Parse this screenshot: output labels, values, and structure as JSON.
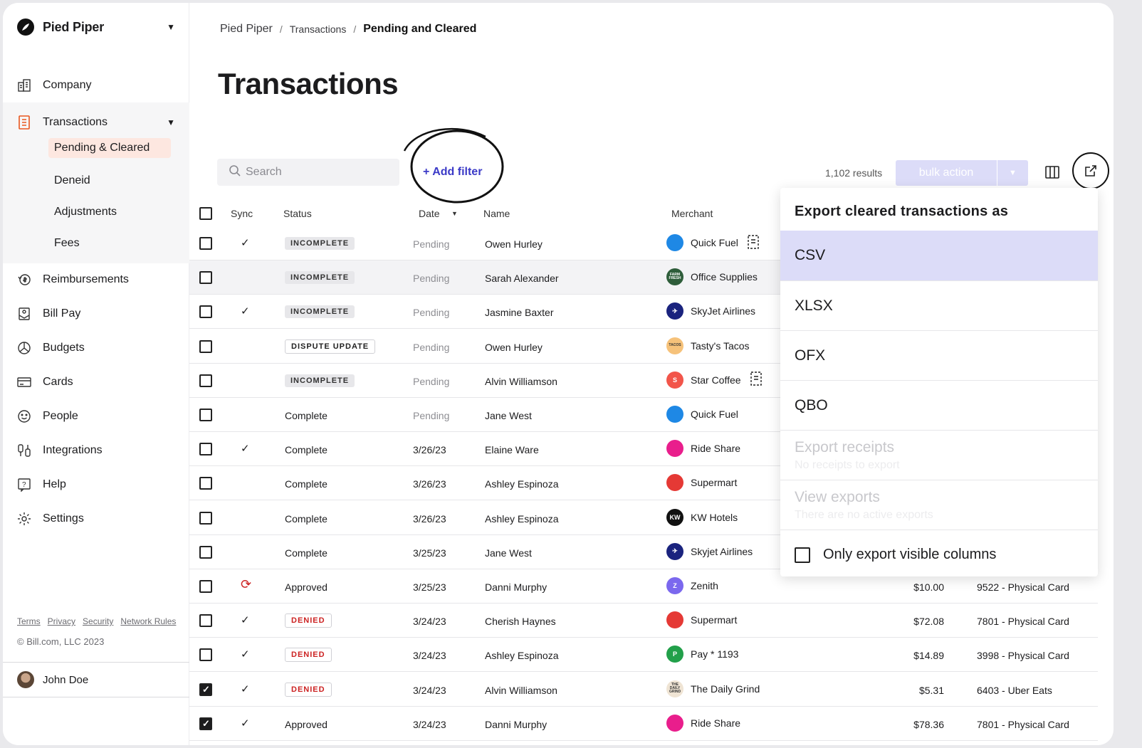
{
  "org": {
    "name": "Pied Piper"
  },
  "nav": {
    "company": "Company",
    "transactions": "Transactions",
    "sub": [
      "Pending & Cleared",
      "Deneid",
      "Adjustments",
      "Fees"
    ],
    "reimbursements": "Reimbursements",
    "bill_pay": "Bill Pay",
    "budgets": "Budgets",
    "cards": "Cards",
    "people": "People",
    "integrations": "Integrations",
    "help": "Help",
    "settings": "Settings"
  },
  "footer": {
    "links": [
      "Terms",
      "Privacy",
      "Security",
      "Network Rules"
    ],
    "copyright": "© Bill.com, LLC 2023"
  },
  "user": {
    "name": "John Doe"
  },
  "breadcrumb": [
    "Pied Piper",
    "Transactions",
    "Pending and Cleared"
  ],
  "page_title": "Transactions",
  "search": {
    "placeholder": "Search"
  },
  "add_filter": "+ Add filter",
  "results": "1,102 results",
  "bulk_action": "bulk action",
  "table": {
    "headers": [
      "Sync",
      "Status",
      "Date",
      "Name",
      "Merchant"
    ],
    "rows": [
      {
        "checked": false,
        "sync": "✓",
        "status": "INCOMPLETE",
        "status_style": "gray",
        "date": "Pending",
        "name": "Owen Hurley",
        "merchant": "Quick Fuel",
        "logo_color": "#1e88e5",
        "logo_text": "",
        "receipt": true,
        "amount": "",
        "card": ""
      },
      {
        "checked": false,
        "sync": "",
        "status": "INCOMPLETE",
        "status_style": "gray",
        "date": "Pending",
        "name": "Sarah Alexander",
        "merchant": "Office Supplies",
        "logo_color": "#2e5d3a",
        "logo_text": "FARM FRESH",
        "receipt": false,
        "amount": "",
        "card": "",
        "highlight": true
      },
      {
        "checked": false,
        "sync": "✓",
        "status": "INCOMPLETE",
        "status_style": "gray",
        "date": "Pending",
        "name": "Jasmine Baxter",
        "merchant": "SkyJet Airlines",
        "logo_color": "#1a237e",
        "logo_text": "✈",
        "receipt": false,
        "amount": "",
        "card": ""
      },
      {
        "checked": false,
        "sync": "",
        "status": "DISPUTE UPDATE",
        "status_style": "outline",
        "date": "Pending",
        "name": "Owen Hurley",
        "merchant": "Tasty's Tacos",
        "logo_color": "#f6c27a",
        "logo_text": "TACOS",
        "receipt": false,
        "amount": "",
        "card": ""
      },
      {
        "checked": false,
        "sync": "",
        "status": "INCOMPLETE",
        "status_style": "gray",
        "date": "Pending",
        "name": "Alvin Williamson",
        "merchant": "Star Coffee",
        "logo_color": "#f2554a",
        "logo_text": "S",
        "receipt": true,
        "amount": "",
        "card": ""
      },
      {
        "checked": false,
        "sync": "",
        "status": "Complete",
        "status_style": "text",
        "date": "Pending",
        "name": "Jane West",
        "merchant": "Quick Fuel",
        "logo_color": "#1e88e5",
        "logo_text": "",
        "receipt": false,
        "amount": "",
        "card": ""
      },
      {
        "checked": false,
        "sync": "✓",
        "status": "Complete",
        "status_style": "text",
        "date": "3/26/23",
        "name": "Elaine Ware",
        "merchant": "Ride Share",
        "logo_color": "#e91e8c",
        "logo_text": "",
        "receipt": false,
        "amount": "",
        "card": ""
      },
      {
        "checked": false,
        "sync": "",
        "status": "Complete",
        "status_style": "text",
        "date": "3/26/23",
        "name": "Ashley Espinoza",
        "merchant": "Supermart",
        "logo_color": "#e53935",
        "logo_text": "",
        "receipt": false,
        "amount": "",
        "card": ""
      },
      {
        "checked": false,
        "sync": "",
        "status": "Complete",
        "status_style": "text",
        "date": "3/26/23",
        "name": "Ashley Espinoza",
        "merchant": "KW Hotels",
        "logo_color": "#111111",
        "logo_text": "KW",
        "receipt": false,
        "amount": "",
        "card": ""
      },
      {
        "checked": false,
        "sync": "",
        "status": "Complete",
        "status_style": "text",
        "date": "3/25/23",
        "name": "Jane West",
        "merchant": "Skyjet Airlines",
        "logo_color": "#1a237e",
        "logo_text": "✈",
        "receipt": false,
        "amount": "",
        "card": ""
      },
      {
        "checked": false,
        "sync": "⟳",
        "status": "Approved",
        "status_style": "text",
        "date": "3/25/23",
        "name": "Danni Murphy",
        "merchant": "Zenith",
        "logo_color": "#7b68ee",
        "logo_text": "Z",
        "receipt": false,
        "amount": "$10.00",
        "card": "9522 - Physical Card"
      },
      {
        "checked": false,
        "sync": "✓",
        "status": "DENIED",
        "status_style": "denied",
        "date": "3/24/23",
        "name": "Cherish Haynes",
        "merchant": "Supermart",
        "logo_color": "#e53935",
        "logo_text": "",
        "receipt": false,
        "amount": "$72.08",
        "card": "7801 - Physical Card"
      },
      {
        "checked": false,
        "sync": "✓",
        "status": "DENIED",
        "status_style": "denied",
        "date": "3/24/23",
        "name": "Ashley Espinoza",
        "merchant": "Pay * 1193",
        "logo_color": "#22a04a",
        "logo_text": "P",
        "receipt": false,
        "amount": "$14.89",
        "card": "3998 - Physical Card"
      },
      {
        "checked": true,
        "sync": "✓",
        "status": "DENIED",
        "status_style": "denied",
        "date": "3/24/23",
        "name": "Alvin Williamson",
        "merchant": "The Daily Grind",
        "logo_color": "#efe4d4",
        "logo_text": "THE DAILY GRIND",
        "receipt": false,
        "amount": "$5.31",
        "card": "6403 - Uber Eats"
      },
      {
        "checked": true,
        "sync": "✓",
        "status": "Approved",
        "status_style": "text",
        "date": "3/24/23",
        "name": "Danni Murphy",
        "merchant": "Ride Share",
        "logo_color": "#e91e8c",
        "logo_text": "",
        "receipt": false,
        "amount": "$78.36",
        "card": "7801 - Physical Card"
      }
    ]
  },
  "export_menu": {
    "title": "Export cleared transactions as",
    "formats": [
      "CSV",
      "XLSX",
      "OFX",
      "QBO"
    ],
    "selected": "CSV",
    "receipts": {
      "label": "Export receipts",
      "sub": "No receipts to export"
    },
    "view_exports": {
      "label": "View exports",
      "sub": "There are no active exports"
    },
    "only_visible": "Only export visible columns"
  },
  "colors": {
    "accent": "#3b3ac7",
    "brand_orange": "#e8571f",
    "selected_row": "#dcdcf8",
    "denied": "#cc2222"
  }
}
